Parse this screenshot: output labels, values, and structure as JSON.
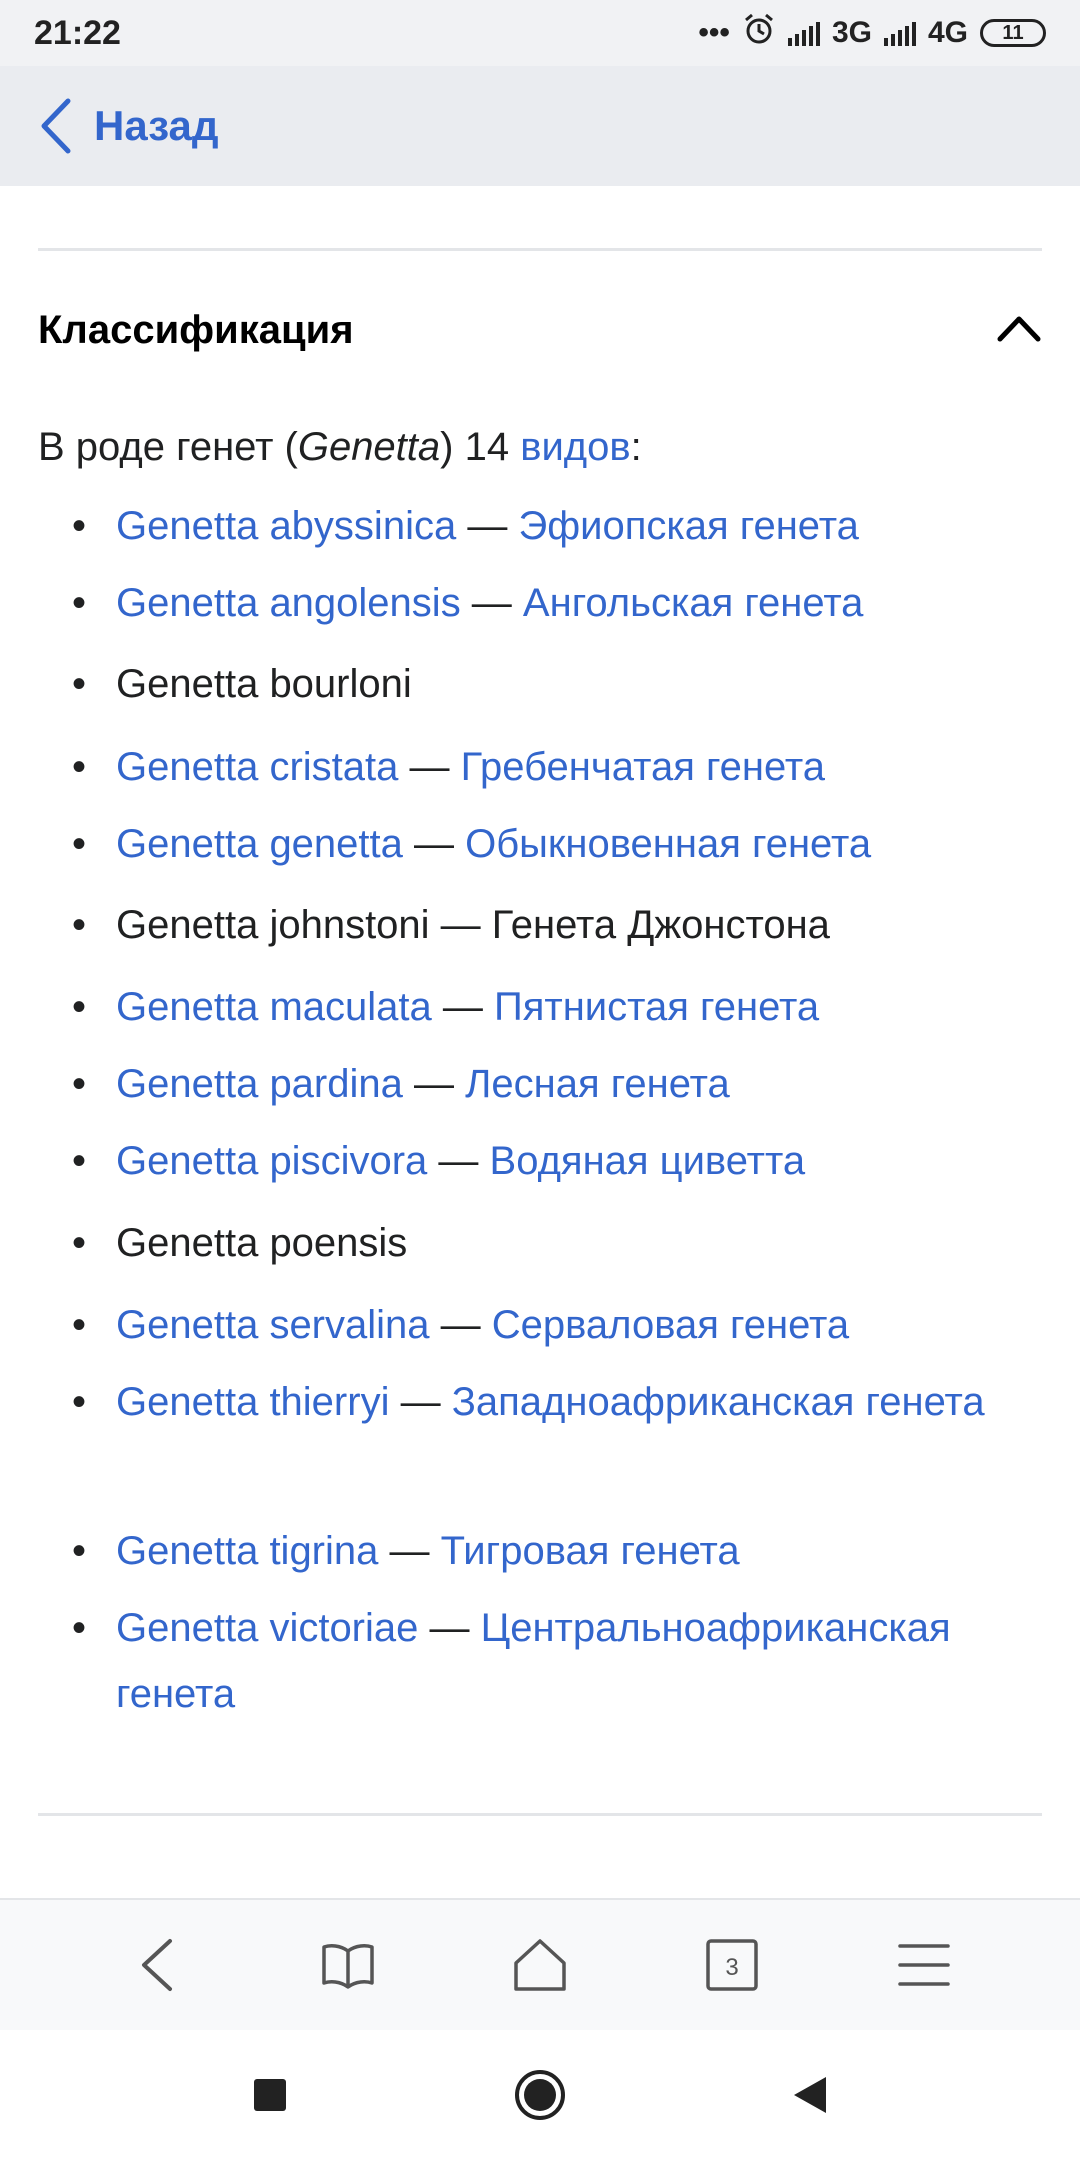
{
  "status_bar": {
    "time": "21:22",
    "dots": "•••",
    "net1": "3G",
    "net2": "4G",
    "battery": "11"
  },
  "top_bar": {
    "back_label": "Назад"
  },
  "section": {
    "title": "Классификация"
  },
  "intro": {
    "prefix": "В роде генет (",
    "genus": "Genetta",
    "middle": ") 14 ",
    "link": "видов",
    "suffix": ":"
  },
  "species": [
    {
      "latin": "Genetta abyssinica",
      "sep": " — ",
      "name": "Эфиопская генета",
      "linked": true
    },
    {
      "latin": "Genetta angolensis",
      "sep": " — ",
      "name": "Ангольская генета",
      "linked": true
    },
    {
      "latin": "Genetta bourloni",
      "sep": "",
      "name": "",
      "linked": false
    },
    {
      "latin": "Genetta cristata",
      "sep": " — ",
      "name": "Гребенчатая генета",
      "linked": true
    },
    {
      "latin": "Genetta genetta",
      "sep": " — ",
      "name": "Обыкновенная генета",
      "linked": true
    },
    {
      "latin": "Genetta johnstoni",
      "sep": " — ",
      "name": "Генета Джонстона",
      "linked": false
    },
    {
      "latin": "Genetta maculata",
      "sep": " — ",
      "name": "Пятнистая генета",
      "linked": true
    },
    {
      "latin": "Genetta pardina",
      "sep": " — ",
      "name": "Лесная генета",
      "linked": true
    },
    {
      "latin": "Genetta piscivora",
      "sep": " — ",
      "name": "Водяная циветта",
      "linked": true
    },
    {
      "latin": "Genetta poensis",
      "sep": "",
      "name": "",
      "linked": false
    },
    {
      "latin": "Genetta servalina",
      "sep": " — ",
      "name": "Серваловая генета",
      "linked": true
    },
    {
      "latin": "Genetta thierryi",
      "sep": " — ",
      "name": "Западноафриканская генета",
      "linked": true
    },
    {
      "latin": "Genetta tigrina",
      "sep": " — ",
      "name": "Тигровая генета",
      "linked": true
    },
    {
      "latin": "Genetta victoriae",
      "sep": " — ",
      "name": "Центральноафриканская генета",
      "linked": true
    }
  ],
  "toolbar": {
    "tabs_count": "3"
  },
  "colors": {
    "link": "#3366cc",
    "text": "#202122",
    "header_bg": "#eaecf0"
  }
}
